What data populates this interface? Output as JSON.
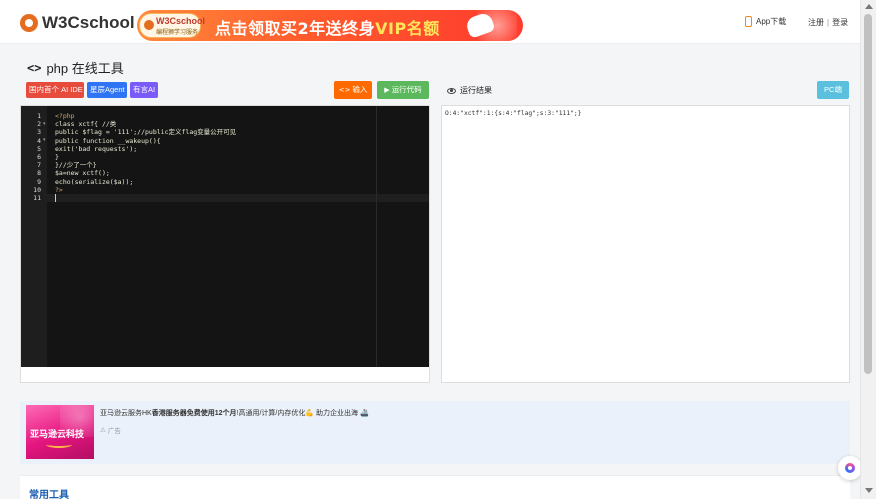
{
  "header": {
    "logo_text": "W3Cschool",
    "banner": {
      "badge_title": "W3Cschool",
      "badge_sub": "编程狮学习服务",
      "headline_pre": "点击领取买2年送终身",
      "headline_vip": "VIP名额"
    },
    "app_download": "App下载",
    "register": "注册",
    "separator": "|",
    "login": "登录"
  },
  "page": {
    "title_icon": "<>",
    "title": "php 在线工具"
  },
  "toolbar": {
    "chip_ai_ide": "国内首个 AI IDE",
    "chip_agent": "星辰Agent",
    "chip_yy": "有言AI",
    "input_icon": "<>",
    "input_label": "输入",
    "run_icon": "▶",
    "run_label": "运行代码",
    "result_label": "运行结果",
    "pc_label": "PC端"
  },
  "editor": {
    "line_numbers": [
      "1",
      "2",
      "3",
      "4",
      "5",
      "6",
      "7",
      "8",
      "9",
      "10",
      "11"
    ],
    "lines": [
      "<?php",
      "class xctf{ //类",
      "public $flag = '111';//public定义flag变量公开可见",
      "public function __wakeup(){",
      "exit('bad requests');",
      "}",
      "}//少了一个}",
      "$a=new xctf();",
      "echo(serialize($a));",
      "?>",
      ""
    ]
  },
  "result": {
    "output": "O:4:\"xctf\":1:{s:4:\"flag\";s:3:\"111\";}"
  },
  "ad": {
    "image_title": "亚马逊云科技",
    "desc_pre": "亚马逊云服务HK",
    "desc_bold": "香港服务器免费使用12个月",
    "desc_post": "!高通用/计算/内存优化💪 助力企业出海 🚢",
    "tag": "广告"
  },
  "section": {
    "common_tools": "常用工具"
  },
  "colors": {
    "brand_orange": "#e56d1f",
    "run_green": "#5cb85c",
    "input_orange": "#ff6a00",
    "pc_blue": "#5bc0de",
    "editor_bg": "#141414"
  }
}
